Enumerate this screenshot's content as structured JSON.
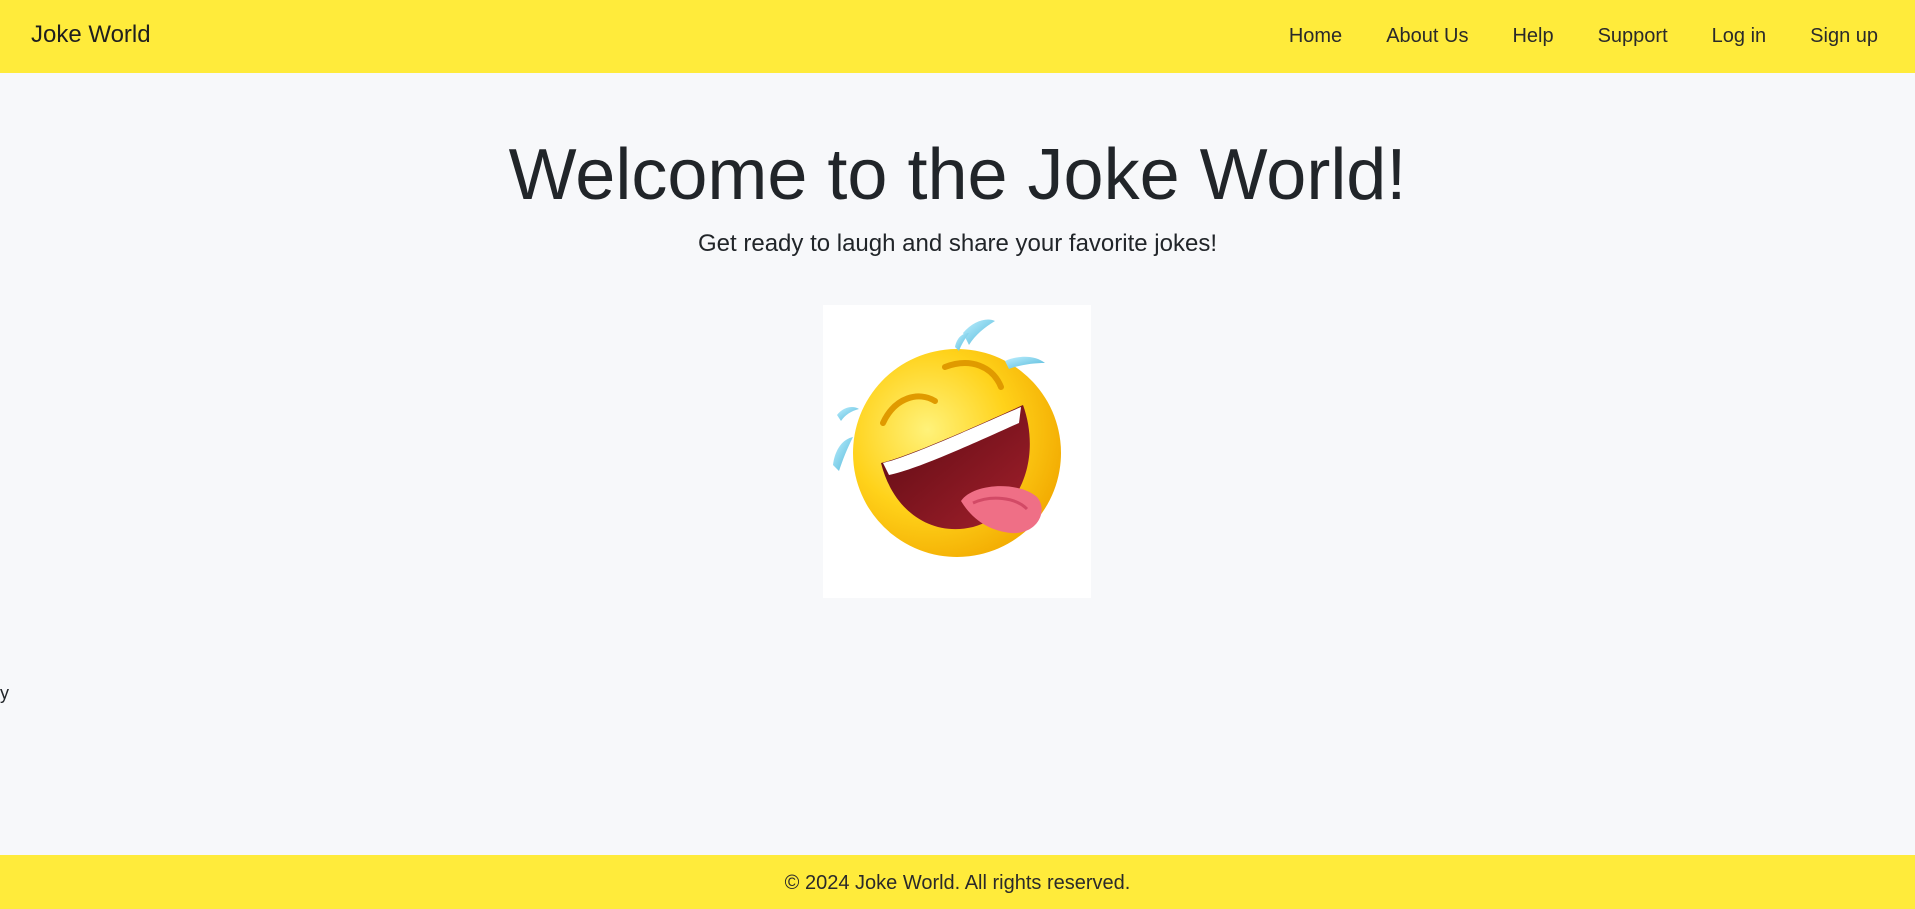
{
  "navbar": {
    "brand": "Joke World",
    "links": [
      {
        "label": "Home"
      },
      {
        "label": "About Us"
      },
      {
        "label": "Help"
      },
      {
        "label": "Support"
      },
      {
        "label": "Log in"
      },
      {
        "label": "Sign up"
      }
    ],
    "background_color": "#ffeb3b"
  },
  "hero": {
    "title": "Welcome to the Joke World!",
    "subtitle": "Get ready to laugh and share your favorite jokes!",
    "image_icon": "laughing-emoji-icon"
  },
  "stray_text": "y",
  "footer": {
    "text": "© 2024 Joke World. All rights reserved.",
    "background_color": "#ffeb3b"
  }
}
